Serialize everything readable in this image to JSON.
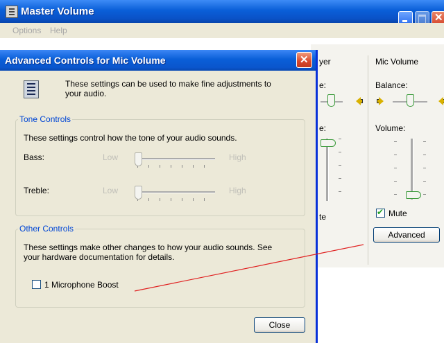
{
  "master_window": {
    "title": "Master Volume",
    "menu": [
      "Options",
      "Help"
    ],
    "column_partial": {
      "title_fragment": "yer",
      "balance_fragment": "e:",
      "volume_fragment": "e:",
      "mute_fragment": "te"
    },
    "mic_column": {
      "title": "Mic Volume",
      "balance_label": "Balance:",
      "volume_label": "Volume:",
      "mute_label": "Mute",
      "mute_checked": true,
      "advanced_button": "Advanced"
    }
  },
  "dialog": {
    "title": "Advanced Controls for Mic Volume",
    "intro": "These settings can be used to make fine adjustments to your audio.",
    "tone": {
      "legend": "Tone Controls",
      "description": "These settings control how the tone of your audio sounds.",
      "bass": {
        "label": "Bass:",
        "low": "Low",
        "high": "High"
      },
      "treble": {
        "label": "Treble:",
        "low": "Low",
        "high": "High"
      }
    },
    "other": {
      "legend": "Other Controls",
      "description": "These settings make other changes to how your audio sounds.  See your hardware documentation for details.",
      "checkbox_label": "1  Microphone Boost",
      "checkbox_checked": false
    },
    "close_button": "Close"
  },
  "colors": {
    "titlebar": "#0a5fd8",
    "dialog_bg": "#ece9d8",
    "legend": "#0046d5",
    "annotation_line": "#e02020"
  },
  "icons": [
    "app-mixer-icon",
    "minimize-icon",
    "maximize-icon",
    "close-icon",
    "speaker-left-icon",
    "speaker-right-icon",
    "dialog-info-icon"
  ]
}
